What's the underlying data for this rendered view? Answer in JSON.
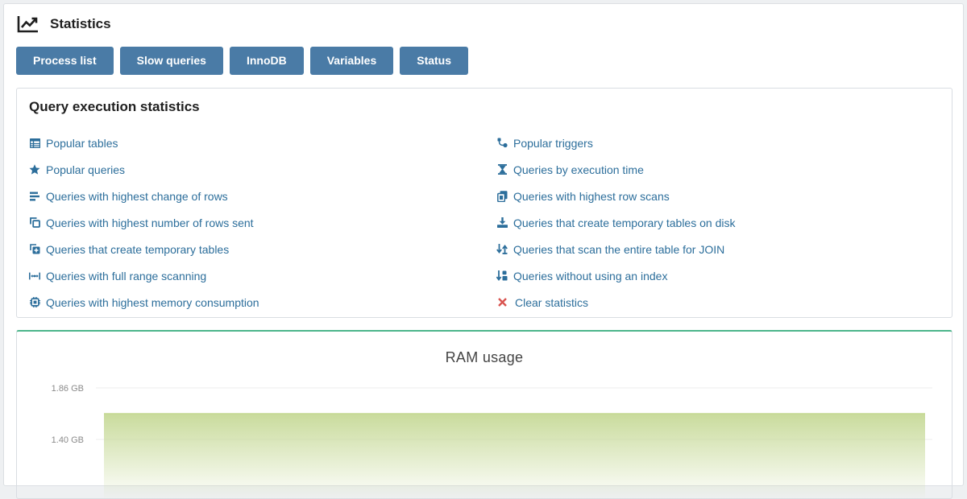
{
  "page": {
    "title": "Statistics"
  },
  "tabs": [
    {
      "label": "Process list",
      "active": true
    },
    {
      "label": "Slow queries",
      "active": false
    },
    {
      "label": "InnoDB",
      "active": false
    },
    {
      "label": "Variables",
      "active": false
    },
    {
      "label": "Status",
      "active": false
    }
  ],
  "query_stats": {
    "title": "Query execution statistics",
    "left_links": [
      {
        "label": "Popular tables",
        "icon": "table-icon"
      },
      {
        "label": "Popular queries",
        "icon": "star-icon"
      },
      {
        "label": "Queries with highest change of rows",
        "icon": "bars-icon"
      },
      {
        "label": "Queries with highest number of rows sent",
        "icon": "clone-icon"
      },
      {
        "label": "Queries that create temporary tables",
        "icon": "plus-square-icon"
      },
      {
        "label": "Queries with full range scanning",
        "icon": "range-icon"
      },
      {
        "label": "Queries with highest memory consumption",
        "icon": "microchip-icon"
      }
    ],
    "right_links": [
      {
        "label": "Popular triggers",
        "icon": "bezier-icon"
      },
      {
        "label": "Queries by execution time",
        "icon": "hourglass-icon"
      },
      {
        "label": "Queries with highest row scans",
        "icon": "sim-card-icon"
      },
      {
        "label": "Queries that create temporary tables on disk",
        "icon": "download-icon"
      },
      {
        "label": "Queries that scan the entire table for JOIN",
        "icon": "sort-arrows-icon"
      },
      {
        "label": "Queries without using an index",
        "icon": "sort-amount-icon"
      },
      {
        "label": "Clear statistics",
        "icon": "close-icon"
      }
    ]
  },
  "colors": {
    "link": "#2c6e9b",
    "tab": "#4a7ba6",
    "tab_active": "#4cb58b",
    "danger": "#d9534f",
    "area_fill": "#c9db9c"
  },
  "chart_data": {
    "type": "area",
    "title": "RAM usage",
    "y_ticks": [
      "1.86 GB",
      "1.40 GB"
    ],
    "y_tick_values": [
      1.86,
      1.4
    ],
    "series": [
      {
        "values": [
          1.63,
          1.63
        ]
      }
    ],
    "grid": true
  }
}
